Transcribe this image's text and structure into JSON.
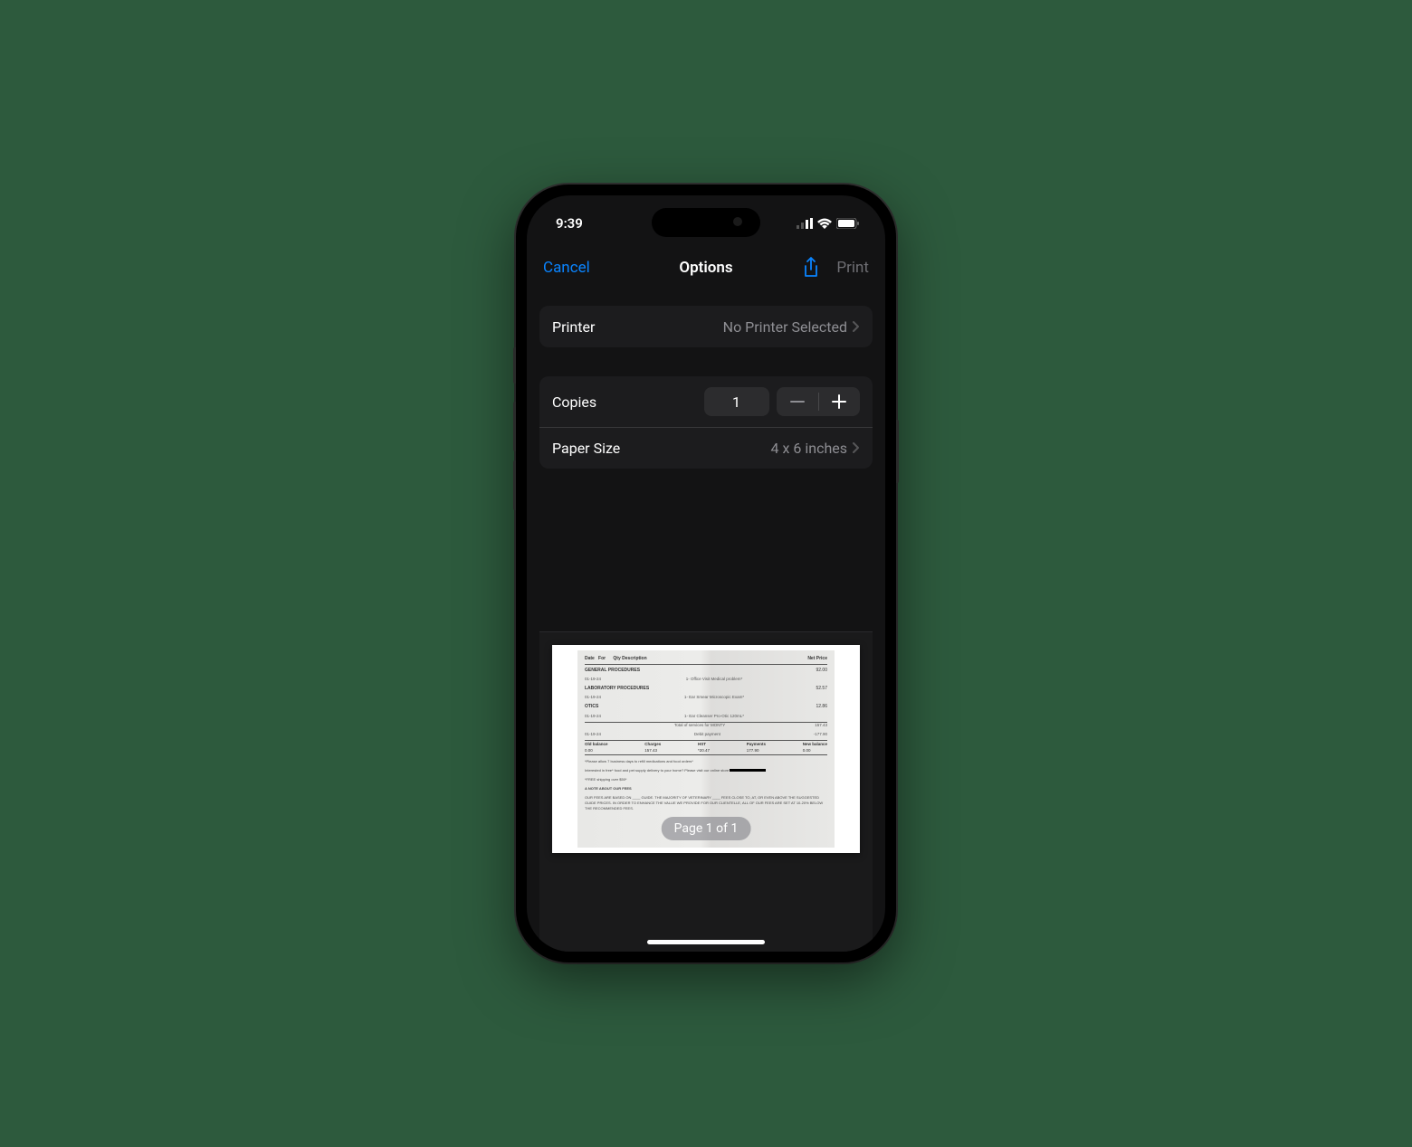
{
  "status": {
    "time": "9:39"
  },
  "nav": {
    "cancel": "Cancel",
    "title": "Options",
    "print": "Print"
  },
  "printer": {
    "label": "Printer",
    "value": "No Printer Selected"
  },
  "copies": {
    "label": "Copies",
    "count": "1"
  },
  "paper": {
    "label": "Paper Size",
    "value": "4 x 6 inches"
  },
  "page_indicator": "Page 1 of 1",
  "receipt": {
    "headers": {
      "date": "Date",
      "for": "For",
      "qty": "Qty",
      "desc": "Description",
      "price": "Net Price"
    },
    "section1": {
      "title": "GENERAL PROCEDURES",
      "date": "01-19-24",
      "desc": "1- Office Visit Medical problem*",
      "price": "92.00"
    },
    "section2": {
      "title": "LABORATORY PROCEDURES",
      "date": "01-19-24",
      "desc": "1- Ear Smear Microscopic Exam*",
      "price": "52.57"
    },
    "section3": {
      "title": "OTICS",
      "date": "01-19-24",
      "desc": "1- Ear Cleanser Pro-Otic 120mL*",
      "price": "12.86"
    },
    "subtotal": {
      "label": "Total of services for MONTY",
      "value": "157.43"
    },
    "pay": {
      "date": "01-19-24",
      "label": "Debit payment",
      "value": "-177.90"
    },
    "totals": {
      "old_bal_l": "Old balance",
      "old_bal_v": "0.00",
      "charges_l": "Charges",
      "charges_v": "157.43",
      "hst_l": "HST",
      "hst_v": "*20.47",
      "payments_l": "Payments",
      "payments_v": "177.90",
      "new_bal_l": "New balance",
      "new_bal_v": "0.00"
    },
    "notes": {
      "n1": "*Please allow 7 business days to refill medications and food orders*",
      "n2": "Interested in free* food and pet supply delivery to your home? Please visit our online store",
      "n3": "*FREE shipping over $50*",
      "n4": "A NOTE ABOUT OUR FEES",
      "n5": "OUR FEES ARE BASED ON ____ GUIDE. THE MAJORITY OF VETERINARY ____ FEES CLOSE TO, AT, OR EVEN ABOVE THE SUGGESTED GUIDE PRICES. IN ORDER TO ENHANCE THE VALUE WE PROVIDE FOR OUR CLIENTELLE, ALL OF OUR FEES ARE SET AT 10-20% BELOW THE RECOMMENDED FEES."
    }
  }
}
